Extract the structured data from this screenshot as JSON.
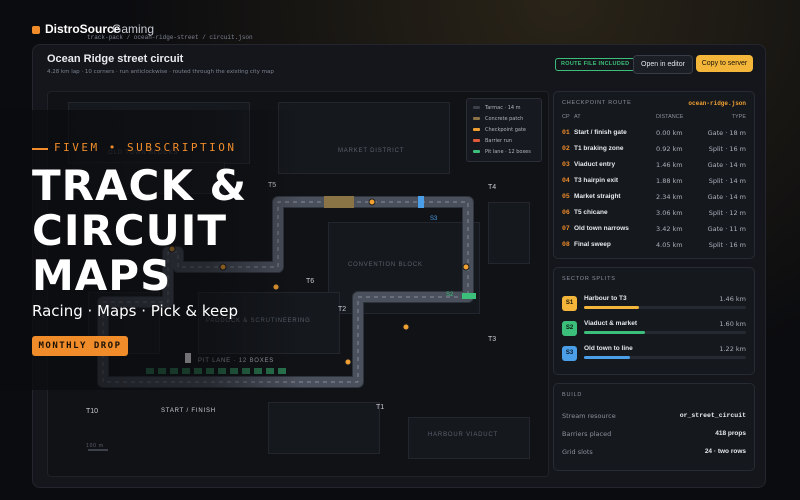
{
  "header": {
    "brand": "DistroSource",
    "brand_sub": "Gaming",
    "breadcrumb": "track-pack / ocean-ridge-street / circuit.json"
  },
  "window": {
    "title": "Ocean Ridge street circuit",
    "subtitle": "4.28 km lap · 10 corners · run anticlockwise · routed through the existing city map",
    "route_badge": "ROUTE FILE INCLUDED",
    "open_editor": "Open in editor",
    "copy_server": "Copy to server"
  },
  "map": {
    "blocks": {
      "market": "MARKET DISTRICT",
      "convention": "CONVENTION BLOCK",
      "paddock": "PADDOCK & SCRUTINEERING",
      "harbour": "HARBOUR VIADUCT",
      "old_town": "OLD TOWN BLOCKS",
      "pit_lane": "PIT LANE · 12 BOXES",
      "start": "START / FINISH",
      "scale": "100 m"
    },
    "legend": [
      {
        "label": "Tarmac · 14 m",
        "color": "#3a3f4a"
      },
      {
        "label": "Concrete patch",
        "color": "#8a7446"
      },
      {
        "label": "Checkpoint gate",
        "color": "#f0a030"
      },
      {
        "label": "Barrier run",
        "color": "#e05a3a"
      },
      {
        "label": "Pit lane · 12 boxes",
        "color": "#3cbf7a"
      }
    ],
    "corners": {
      "t1": "T1",
      "t2": "T2",
      "t3": "T3",
      "t4": "T4",
      "t5": "T5",
      "t6": "T6",
      "t10": "T10"
    },
    "sectors": {
      "s2": "S2",
      "s3": "S3"
    }
  },
  "checkpoints": {
    "title": "CHECKPOINT ROUTE",
    "file": "ocean-ridge.json",
    "headers": {
      "cp": "CP",
      "at": "AT",
      "distance": "DISTANCE",
      "type": "TYPE"
    },
    "rows": [
      {
        "idx": "01",
        "name": "Start / finish gate",
        "dist": "0.00 km",
        "type": "Gate · 18 m"
      },
      {
        "idx": "02",
        "name": "T1 braking zone",
        "dist": "0.92 km",
        "type": "Split · 16 m"
      },
      {
        "idx": "03",
        "name": "Viaduct entry",
        "dist": "1.46 km",
        "type": "Gate · 14 m"
      },
      {
        "idx": "04",
        "name": "T3 hairpin exit",
        "dist": "1.88 km",
        "type": "Split · 14 m"
      },
      {
        "idx": "05",
        "name": "Market straight",
        "dist": "2.34 km",
        "type": "Gate · 14 m"
      },
      {
        "idx": "06",
        "name": "T5 chicane",
        "dist": "3.06 km",
        "type": "Split · 12 m"
      },
      {
        "idx": "07",
        "name": "Old town narrows",
        "dist": "3.42 km",
        "type": "Gate · 11 m"
      },
      {
        "idx": "08",
        "name": "Final sweep",
        "dist": "4.05 km",
        "type": "Split · 16 m"
      }
    ]
  },
  "sectors": {
    "title": "SECTOR SPLITS",
    "rows": [
      {
        "tag": "S1",
        "name": "Harbour to T3",
        "value": "1.46 km",
        "fraction": 0.34,
        "color": "#f3b53a"
      },
      {
        "tag": "S2",
        "name": "Viaduct & market",
        "value": "1.60 km",
        "fraction": 0.374,
        "color": "#3cbf7a"
      },
      {
        "tag": "S3",
        "name": "Old town to line",
        "value": "1.22 km",
        "fraction": 0.285,
        "color": "#4a9fe8"
      }
    ]
  },
  "build": {
    "title": "BUILD",
    "rows": [
      {
        "key": "Stream resource",
        "value": "or_street_circuit"
      },
      {
        "key": "Barriers placed",
        "value": "418 props"
      },
      {
        "key": "Grid slots",
        "value": "24 · two rows"
      }
    ]
  },
  "promo": {
    "kicker": "FIVEM • SUBSCRIPTION",
    "title_lines": [
      "TRACK &",
      "CIRCUIT",
      "MAPS"
    ],
    "tagline": "Racing · Maps · Pick & keep",
    "cta": "MONTHLY DROP"
  }
}
